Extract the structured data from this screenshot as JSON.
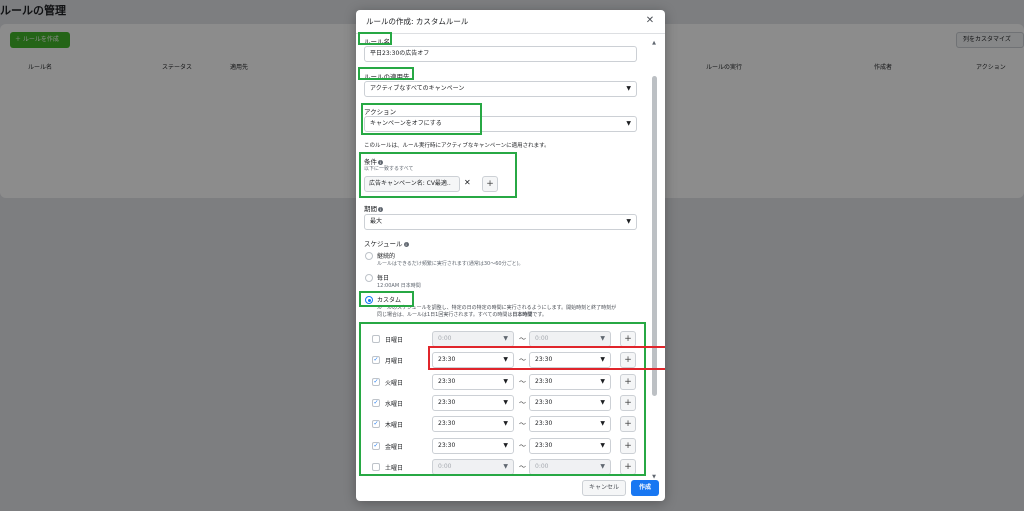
{
  "background": {
    "title": "ルールの管理",
    "create_button": "＋ ルールを作成",
    "customize_button": "列をカスタマイズ",
    "columns": [
      "ルール名",
      "ステータス",
      "適用先",
      "ルールの実行",
      "作成者",
      "アクション"
    ]
  },
  "modal": {
    "title": "ルールの作成: カスタムルール",
    "rule_name_label": "ルール名",
    "rule_name_value": "平日23:30の広告オフ",
    "apply_to_label": "ルールの適用先",
    "apply_to_value": "アクティブなすべてのキャンペーン",
    "action_label": "アクション",
    "action_value": "キャンペーンをオフにする",
    "action_note": "このルールは、ルール実行時にアクティブなキャンペーンに適用されます。",
    "conditions_label": "条件",
    "conditions_sub": "以下に一致するすべて",
    "condition_chip": "広告キャンペーン名: CV最適..",
    "duration_label": "期間",
    "duration_value": "最大",
    "schedule_label": "スケジュール",
    "schedule_options": [
      {
        "label": "継続的",
        "desc": "ルールはできるだけ頻繁に実行されます(通常は30〜60分ごと)。"
      },
      {
        "label": "毎日",
        "desc": "12:00AM 日本時間"
      },
      {
        "label": "カスタム",
        "desc1": "ルールのスケジュールを調整し、特定の日の特定の時間に実行されるようにします。開始時刻と終了時刻が",
        "desc2": "同じ場合は、ルールは1日1回実行されます。すべての時間は",
        "desc2_bold": "日本時間",
        "desc2_end": "です。"
      }
    ],
    "days": [
      {
        "name": "日曜日",
        "checked": false,
        "start": "0:00",
        "end": "0:00"
      },
      {
        "name": "月曜日",
        "checked": true,
        "start": "23:30",
        "end": "23:30"
      },
      {
        "name": "火曜日",
        "checked": true,
        "start": "23:30",
        "end": "23:30"
      },
      {
        "name": "水曜日",
        "checked": true,
        "start": "23:30",
        "end": "23:30"
      },
      {
        "name": "木曜日",
        "checked": true,
        "start": "23:30",
        "end": "23:30"
      },
      {
        "name": "金曜日",
        "checked": true,
        "start": "23:30",
        "end": "23:30"
      },
      {
        "name": "土曜日",
        "checked": false,
        "start": "0:00",
        "end": "0:00"
      }
    ],
    "tilde": "〜",
    "plus": "+",
    "cancel_label": "キャンセル",
    "create_label": "作成"
  },
  "icons": {
    "close": "close-icon",
    "caret": "caret-down-icon",
    "info": "info-icon",
    "remove": "remove-icon",
    "check": "checkmark-icon"
  },
  "colors": {
    "highlight_green": "#27a844",
    "highlight_red": "#e0252b",
    "primary": "#1877f2"
  }
}
